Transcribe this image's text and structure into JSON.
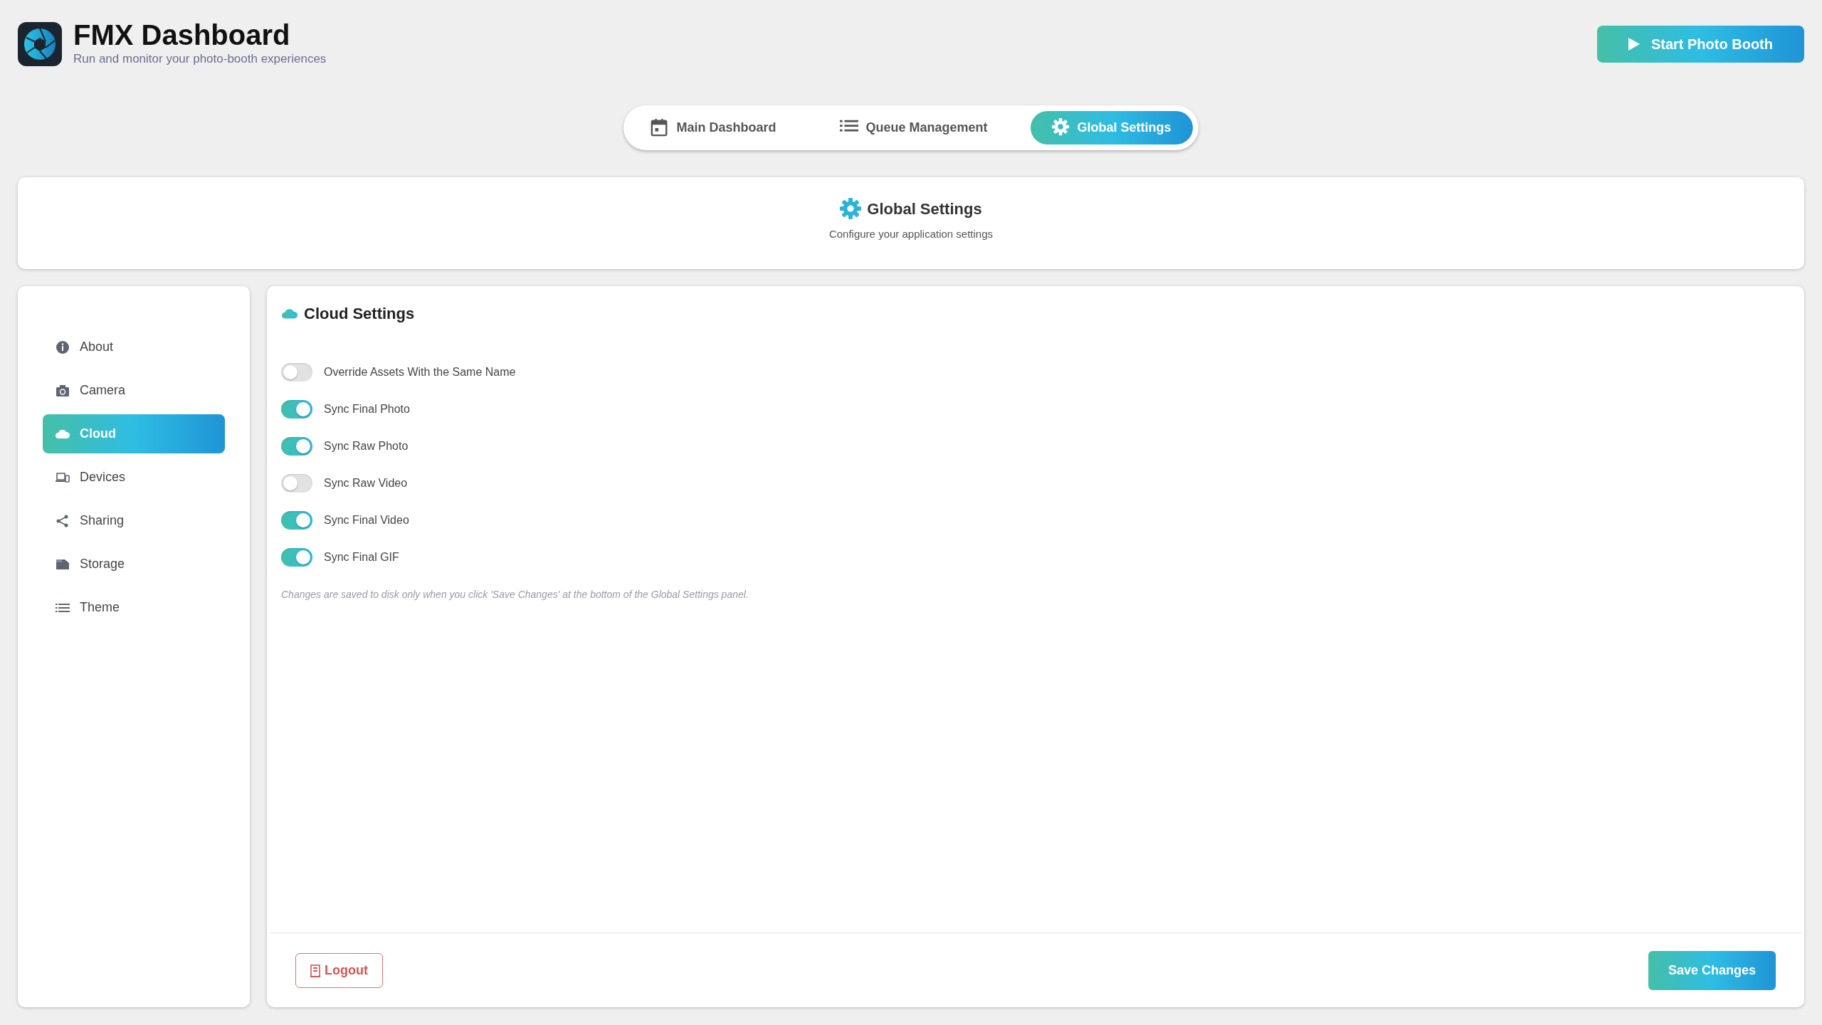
{
  "header": {
    "title": "FMX Dashboard",
    "subtitle": "Run and monitor your photo-booth experiences"
  },
  "start_button": {
    "label": "Start Photo Booth"
  },
  "tabs": [
    {
      "label": "Main Dashboard",
      "selected": false
    },
    {
      "label": "Queue Management",
      "selected": false
    },
    {
      "label": "Global Settings",
      "selected": true
    }
  ],
  "page_header": {
    "title": "Global Settings",
    "subtitle": "Configure your application settings"
  },
  "sidebar": {
    "items": [
      {
        "label": "About",
        "selected": false
      },
      {
        "label": "Camera",
        "selected": false
      },
      {
        "label": "Cloud",
        "selected": true
      },
      {
        "label": "Devices",
        "selected": false
      },
      {
        "label": "Sharing",
        "selected": false
      },
      {
        "label": "Storage",
        "selected": false
      },
      {
        "label": "Theme",
        "selected": false
      }
    ]
  },
  "section": {
    "title": "Cloud Settings"
  },
  "settings": [
    {
      "label": "Override Assets With the Same Name",
      "on": false
    },
    {
      "label": "Sync Final Photo",
      "on": true
    },
    {
      "label": "Sync Raw Photo",
      "on": true
    },
    {
      "label": "Sync Raw Video",
      "on": false
    },
    {
      "label": "Sync Final Video",
      "on": true
    },
    {
      "label": "Sync Final GIF",
      "on": true
    }
  ],
  "note": "Changes are saved to disk only when you click 'Save Changes' at the bottom of the Global Settings panel.",
  "footer": {
    "logout": "Logout",
    "save": "Save Changes"
  }
}
